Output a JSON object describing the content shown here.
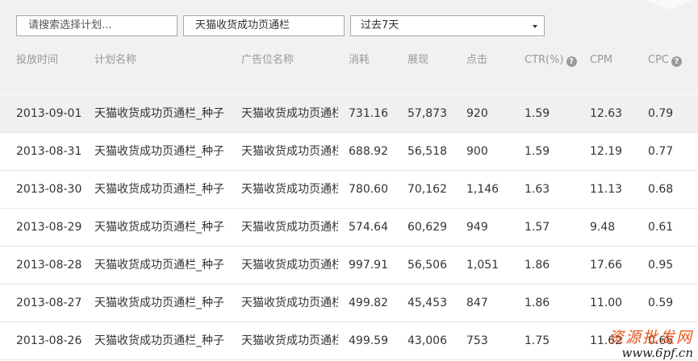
{
  "filters": {
    "plan_placeholder": "请搜索选择计划...",
    "position_value": "天猫收货成功页通栏",
    "date_range_value": "过去7天"
  },
  "table": {
    "headers": {
      "date": "投放时间",
      "plan_name": "计划名称",
      "position_name": "广告位名称",
      "cost": "消耗",
      "impressions": "展现",
      "clicks": "点击",
      "ctr": "CTR(%)",
      "cpm": "CPM",
      "cpc": "CPC"
    },
    "rows": [
      {
        "date": "2013-09-01",
        "plan_name": "天猫收货成功页通栏_种子",
        "position_name": "天猫收货成功页通栏",
        "cost": "731.16",
        "impressions": "57,873",
        "clicks": "920",
        "ctr": "1.59",
        "cpm": "12.63",
        "cpc": "0.79"
      },
      {
        "date": "2013-08-31",
        "plan_name": "天猫收货成功页通栏_种子",
        "position_name": "天猫收货成功页通栏",
        "cost": "688.92",
        "impressions": "56,518",
        "clicks": "900",
        "ctr": "1.59",
        "cpm": "12.19",
        "cpc": "0.77"
      },
      {
        "date": "2013-08-30",
        "plan_name": "天猫收货成功页通栏_种子",
        "position_name": "天猫收货成功页通栏",
        "cost": "780.60",
        "impressions": "70,162",
        "clicks": "1,146",
        "ctr": "1.63",
        "cpm": "11.13",
        "cpc": "0.68"
      },
      {
        "date": "2013-08-29",
        "plan_name": "天猫收货成功页通栏_种子",
        "position_name": "天猫收货成功页通栏",
        "cost": "574.64",
        "impressions": "60,629",
        "clicks": "949",
        "ctr": "1.57",
        "cpm": "9.48",
        "cpc": "0.61"
      },
      {
        "date": "2013-08-28",
        "plan_name": "天猫收货成功页通栏_种子",
        "position_name": "天猫收货成功页通栏",
        "cost": "997.91",
        "impressions": "56,506",
        "clicks": "1,051",
        "ctr": "1.86",
        "cpm": "17.66",
        "cpc": "0.95"
      },
      {
        "date": "2013-08-27",
        "plan_name": "天猫收货成功页通栏_种子",
        "position_name": "天猫收货成功页通栏",
        "cost": "499.82",
        "impressions": "45,453",
        "clicks": "847",
        "ctr": "1.86",
        "cpm": "11.00",
        "cpc": "0.59"
      },
      {
        "date": "2013-08-26",
        "plan_name": "天猫收货成功页通栏_种子",
        "position_name": "天猫收货成功页通栏",
        "cost": "499.59",
        "impressions": "43,006",
        "clicks": "753",
        "ctr": "1.75",
        "cpm": "11.62",
        "cpc": "0.66"
      }
    ]
  },
  "watermark": {
    "chinese": "资源批发网",
    "domain": "www.6pf.cn"
  }
}
